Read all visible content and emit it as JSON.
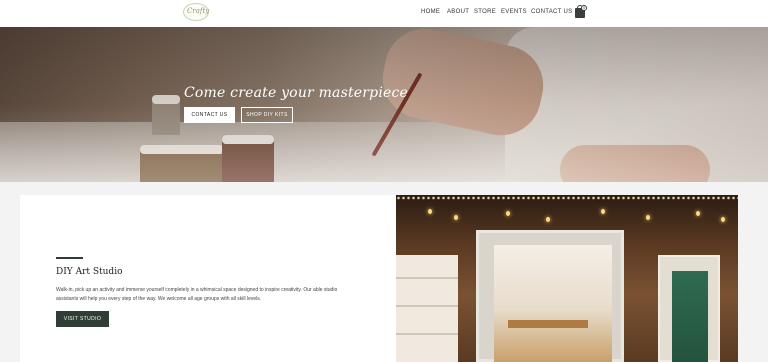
{
  "header": {
    "logo_text": "Crafty",
    "nav": [
      "HOME",
      "ABOUT",
      "STORE",
      "EVENTS",
      "CONTACT US"
    ],
    "cart_count": "0"
  },
  "hero": {
    "title": "Come create your masterpiece",
    "contact_label": "CONTACT US",
    "kits_label": "SHOP DIY KITS"
  },
  "studio": {
    "title": "DIY Art Studio",
    "text": "Walk-in, pick up an activity and immerse yourself completely in a whimsical space designed to inspire creativity. Our able studio assistants will help you every step of the way. We welcome all age groups with all skill levels.",
    "button_label": "VISIT STUDIO"
  },
  "colors": {
    "accent_dark_green": "#2f3f35",
    "header_bg": "#ffffff",
    "page_bg": "#f3f3f3"
  },
  "icons": {
    "cart": "shopping-bag-icon"
  }
}
